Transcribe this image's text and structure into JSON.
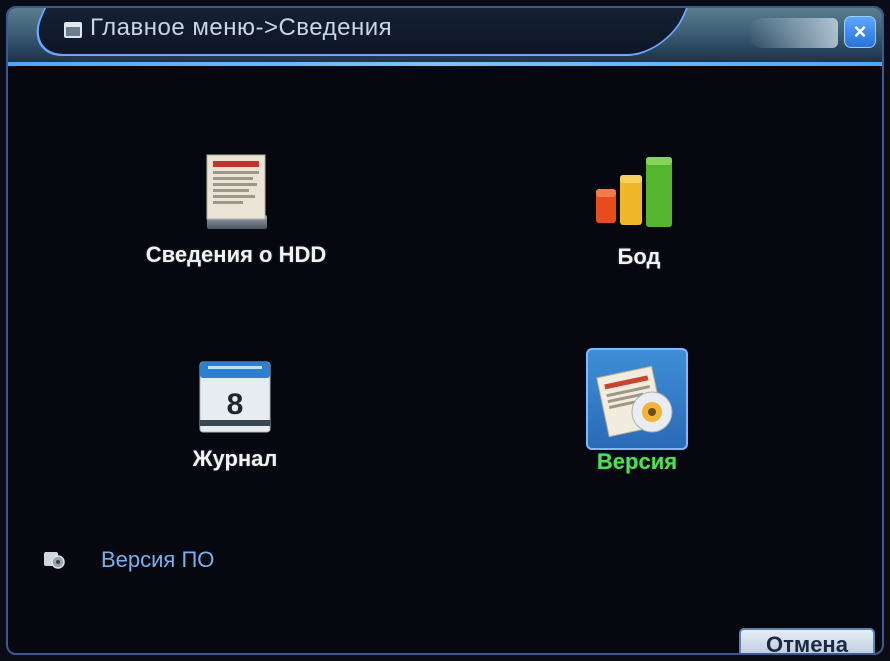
{
  "window": {
    "title": "Главное меню->Сведения",
    "close_glyph": "×"
  },
  "menu": {
    "items": [
      {
        "label": "Сведения о HDD",
        "icon": "hdd-report-icon",
        "selected": false
      },
      {
        "label": "Бод",
        "icon": "signal-bars-icon",
        "selected": false
      },
      {
        "label": "Журнал",
        "icon": "calendar-icon",
        "selected": false
      },
      {
        "label": "Версия",
        "icon": "document-disc-icon",
        "selected": true
      }
    ]
  },
  "calendar_day": "8",
  "software_version": {
    "label": "Версия ПО",
    "icon": "settings-icon"
  },
  "buttons": {
    "cancel_label": "Отмена"
  },
  "colors": {
    "accent": "#4aa8ff",
    "selected_text": "#4fe04f",
    "link_text": "#79b0f0"
  }
}
